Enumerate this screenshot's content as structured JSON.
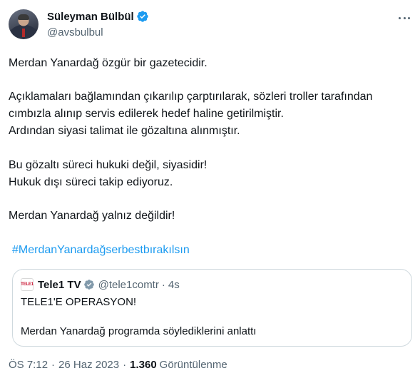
{
  "author": {
    "name": "Süleyman Bülbül",
    "handle": "@avsbulbul"
  },
  "tweet": {
    "paragraphs": [
      "Merdan Yanardağ özgür bir gazetecidir.",
      "Açıklamaları bağlamından çıkarılıp çarptırılarak, sözleri troller tarafından",
      "cımbızla alınıp servis edilerek hedef haline getirilmiştir.",
      "Ardından siyasi talimat ile gözaltına alınmıştır.",
      "Bu gözaltı süreci hukuki değil, siyasidir!",
      "Hukuk dışı süreci takip ediyoruz.",
      "Merdan Yanardağ yalnız değildir!"
    ],
    "hashtag": "#MerdanYanardağserbestbırakılsın"
  },
  "quoted": {
    "logo_text": "TELE1",
    "name": "Tele1 TV",
    "handle": "@tele1comtr",
    "separator": "·",
    "time": "4s",
    "line1": "TELE1'E OPERASYON!",
    "line2": "Merdan Yanardağ programda söylediklerini anlattı"
  },
  "meta": {
    "time": "ÖS 7:12",
    "separator": "·",
    "date": "26 Haz 2023",
    "views_count": "1.360",
    "views_label": "Görüntülenme"
  },
  "colors": {
    "accent": "#1d9bf0",
    "text": "#0f1419",
    "secondary": "#536471",
    "border": "#cfd9de",
    "verified": "#1d9bf0",
    "quote_verified": "#829aab"
  }
}
